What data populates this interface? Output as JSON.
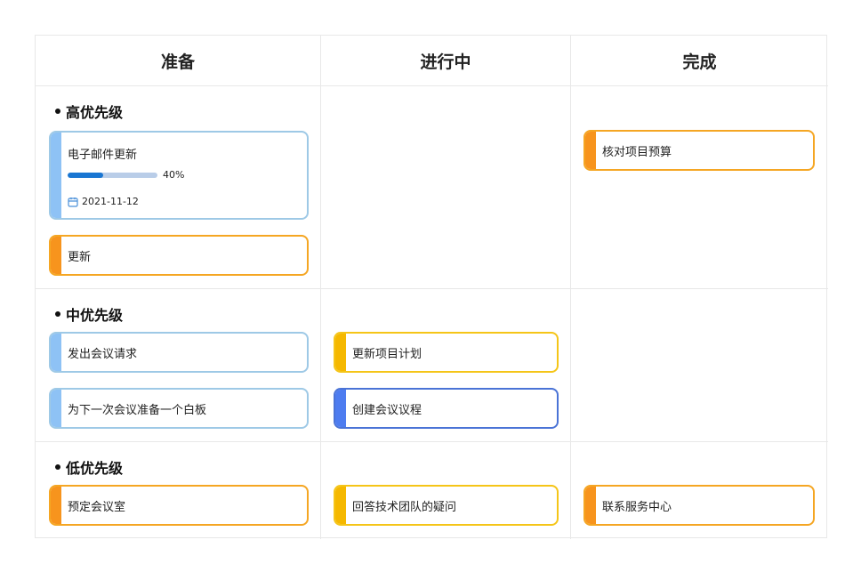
{
  "columns": [
    {
      "title": "准备"
    },
    {
      "title": "进行中"
    },
    {
      "title": "完成"
    }
  ],
  "groups": {
    "high": {
      "title": "高优先级"
    },
    "medium": {
      "title": "中优先级"
    },
    "low": {
      "title": "低优先级"
    }
  },
  "cards": {
    "email_update": {
      "label": "电子邮件更新",
      "progress_percent": 40,
      "progress_text": "40%",
      "date": "2021-11-12",
      "date_icon": "calendar-icon",
      "color": "#8ec2f5"
    },
    "update": {
      "label": "更新",
      "color": "#f7941d"
    },
    "check_budget": {
      "label": "核对项目预算",
      "color": "#f7941d"
    },
    "send_meeting_request": {
      "label": "发出会议请求",
      "color": "#8ec2f5"
    },
    "prepare_whiteboard": {
      "label": "为下一次会议准备一个白板",
      "color": "#8ec2f5"
    },
    "update_project_plan": {
      "label": "更新项目计划",
      "color": "#f5b800"
    },
    "create_agenda": {
      "label": "创建会议议程",
      "color": "#4d7cf0"
    },
    "book_room": {
      "label": "预定会议室",
      "color": "#f7941d"
    },
    "answer_questions": {
      "label": "回答技术团队的疑问",
      "color": "#f5b800"
    },
    "contact_service": {
      "label": "联系服务中心",
      "color": "#f7941d"
    }
  }
}
